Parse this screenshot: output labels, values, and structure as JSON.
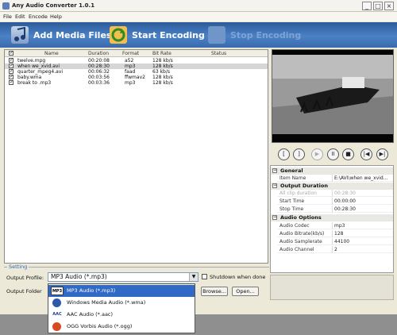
{
  "window": {
    "title": "Any Audio Converter 1.0.1"
  },
  "menu": [
    "File",
    "Edit",
    "Encode",
    "Help"
  ],
  "toolbar": {
    "add": "Add Media Files",
    "start": "Start Encoding",
    "stop": "Stop Encoding"
  },
  "list": {
    "headers": {
      "name": "Name",
      "duration": "Duration",
      "format": "Format",
      "bitrate": "Bit Rate",
      "status": "Status"
    },
    "rows": [
      {
        "name": "twelve.mpg",
        "duration": "00:20:08",
        "format": "a52",
        "bitrate": "128 kb/s",
        "checked": true,
        "selected": false
      },
      {
        "name": "when we_xvid.avi",
        "duration": "00:28:30",
        "format": "mp3",
        "bitrate": "128 kb/s",
        "checked": true,
        "selected": true
      },
      {
        "name": "quarter_mpeg4.avi",
        "duration": "00:06:32",
        "format": "faad",
        "bitrate": "63 kb/s",
        "checked": true,
        "selected": false
      },
      {
        "name": "baby.wma",
        "duration": "00:03:56",
        "format": "ffwmav2",
        "bitrate": "128 kb/s",
        "checked": true,
        "selected": false
      },
      {
        "name": "break to .mp3",
        "duration": "00:03:36",
        "format": "mp3",
        "bitrate": "128 kb/s",
        "checked": true,
        "selected": false
      }
    ]
  },
  "controls": [
    "[",
    "]",
    "▶",
    "II",
    "■",
    "|◀",
    "▶|"
  ],
  "props": {
    "general": "General",
    "item_name_k": "Item Name",
    "item_name_v": "E:\\AVI\\when we_xvid...",
    "output_duration": "Output Duration",
    "all_clip_k": "All clip duration",
    "all_clip_v": "00:28:30",
    "start_k": "Start Time",
    "start_v": "00:00:00",
    "stop_k": "Stop Time",
    "stop_v": "00:28:30",
    "audio_options": "Audio Options",
    "codec_k": "Audio Codec",
    "codec_v": "mp3",
    "bitrate_k": "Audio Bitrate(kb/s)",
    "bitrate_v": "128",
    "samplerate_k": "Audio Samplerate",
    "samplerate_v": "44100",
    "channel_k": "Audio Channel",
    "channel_v": "2"
  },
  "setting": {
    "legend": "Setting",
    "profile_label": "Output Profile:",
    "profile_value": "MP3 Audio (*.mp3)",
    "shutdown_label": "Shutdown when done",
    "folder_label": "Output Folder",
    "browse": "Browse...",
    "open": "Open..."
  },
  "dropdown": [
    {
      "icon": "MP3",
      "label": "MP3 Audio (*.mp3)",
      "selected": true
    },
    {
      "icon": "",
      "label": "Windows Media Audio (*.wma)",
      "selected": false
    },
    {
      "icon": "AAC",
      "label": "AAC Audio (*.aac)",
      "selected": false
    },
    {
      "icon": "",
      "label": "OGG Vorbis Audio (*.ogg)",
      "selected": false
    }
  ]
}
